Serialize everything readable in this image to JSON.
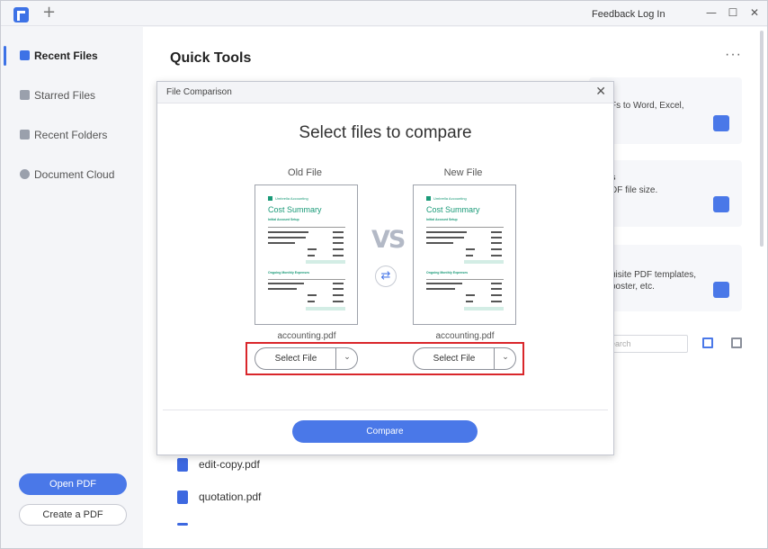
{
  "titlebar": {
    "new_tab": "+",
    "feedback": "Feedback",
    "login": "Log In",
    "minimize": "—",
    "maximize": "☐",
    "close": "✕"
  },
  "sidebar": {
    "items": [
      {
        "label": "Recent Files",
        "icon": "recent-files-icon",
        "active": true
      },
      {
        "label": "Starred Files",
        "icon": "star-icon",
        "active": false
      },
      {
        "label": "Recent Folders",
        "icon": "folder-icon",
        "active": false
      },
      {
        "label": "Document Cloud",
        "icon": "cloud-icon",
        "active": false
      }
    ],
    "open_pdf": "Open PDF",
    "create_pdf": "Create a PDF"
  },
  "main": {
    "title": "Quick Tools",
    "more": "···",
    "tool_cards": [
      {
        "text": "Fs to Word, Excel,",
        "icon": "convert-icon"
      },
      {
        "text_line1": "s",
        "text_line2": "DF file size.",
        "icon": "compress-icon"
      },
      {
        "text_line1": "uisite PDF templates,",
        "text_line2": "poster, etc.",
        "icon": "template-icon"
      }
    ],
    "search_placeholder": "earch",
    "files": [
      {
        "name": "edit-copy.pdf"
      },
      {
        "name": "quotation.pdf"
      }
    ]
  },
  "modal": {
    "title": "File Comparison",
    "close": "✕",
    "heading": "Select files to compare",
    "old_label": "Old File",
    "new_label": "New File",
    "vs": "VS",
    "swap": "⇄",
    "old_file_name": "accounting.pdf",
    "new_file_name": "accounting.pdf",
    "select_file": "Select File",
    "dropdown": "⌄",
    "compare": "Compare",
    "doc_preview": {
      "brand": "Umbrella Accounting",
      "title": "Cost Summary",
      "section1": "Initial Account Setup",
      "section2": "Ongoing Monthly Expenses"
    }
  },
  "colors": {
    "accent": "#4a78e8",
    "highlight": "#d9262b",
    "doc_green": "#1a9a78"
  }
}
